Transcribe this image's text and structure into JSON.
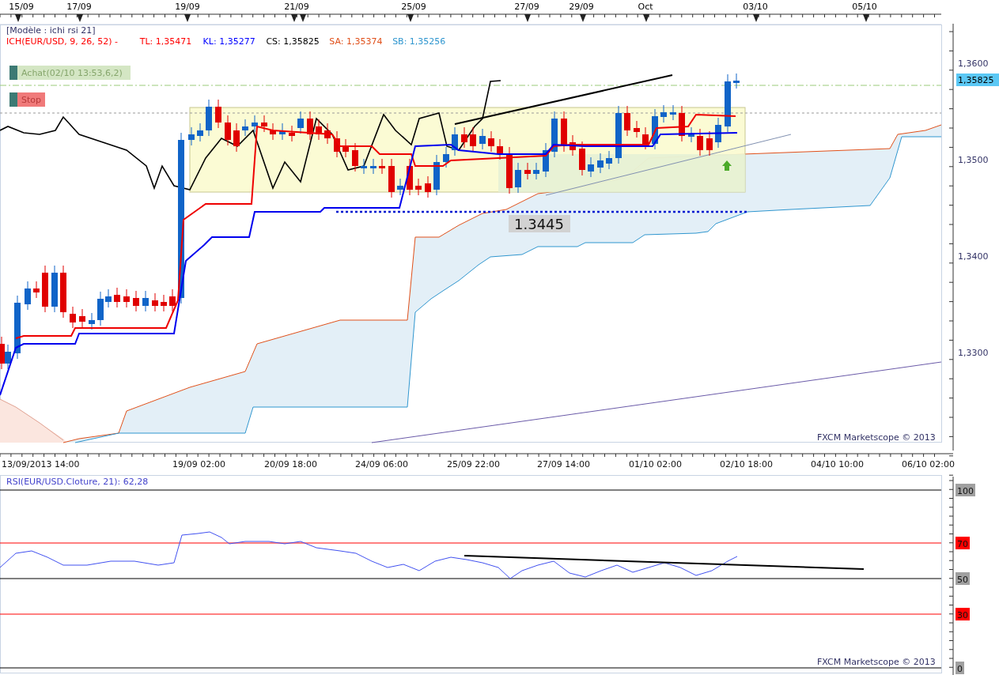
{
  "date_axis": {
    "labels": [
      "15/09",
      "17/09",
      "19/09",
      "21/09",
      "25/09",
      "27/09",
      "29/09",
      "Oct",
      "03/10",
      "05/10"
    ]
  },
  "legend": {
    "template": "[Modèle : ichi rsi 21]",
    "indicators": [
      {
        "text": "ICH(EUR/USD, 9, 26, 52) -",
        "color": "#ff0000"
      },
      {
        "text": "TL: 1,35471",
        "color": "#ff0000"
      },
      {
        "text": "KL: 1,35277",
        "color": "#0000ff"
      },
      {
        "text": "CS: 1,35825",
        "color": "#000000"
      },
      {
        "text": "SA: 1,35374",
        "color": "#e0501a"
      },
      {
        "text": "SB: 1,35256",
        "color": "#2f96cf"
      }
    ]
  },
  "order_labels": [
    {
      "kind": "buy",
      "text": "Achat(02/10 13:53,6,2)"
    },
    {
      "kind": "stop",
      "text": "Stop"
    }
  ],
  "price_axis": {
    "labels": [
      {
        "text": "1,3600",
        "current": false
      },
      {
        "text": "1,35825",
        "current": true
      },
      {
        "text": "1,3500",
        "current": false
      },
      {
        "text": "1,3400",
        "current": false
      },
      {
        "text": "1,3300",
        "current": false
      }
    ]
  },
  "level_label": "1.3445",
  "price_copyright": "FXCM Marketscope © 2013",
  "time_axis": {
    "labels": [
      "13/09/2013 14:00",
      "19/09 02:00",
      "20/09 18:00",
      "24/09 06:00",
      "25/09 22:00",
      "27/09 14:00",
      "01/10 02:00",
      "02/10 18:00",
      "04/10 10:00",
      "06/10 02:00"
    ]
  },
  "rsi": {
    "title": "RSI(EUR/USD.Cloture, 21): 62,28",
    "levels": [
      {
        "text": "100",
        "color": "#a0a0a0"
      },
      {
        "text": "70",
        "color": "#ff0000"
      },
      {
        "text": "50",
        "color": "#a0a0a0"
      },
      {
        "text": "30",
        "color": "#ff0000"
      },
      {
        "text": "0",
        "color": "#a0a0a0"
      }
    ],
    "copyright": "FXCM Marketscope © 2013"
  }
}
